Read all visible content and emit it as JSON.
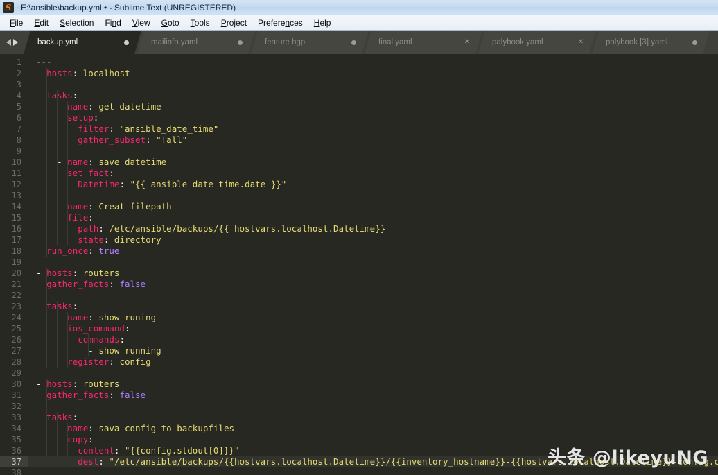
{
  "window": {
    "title": "E:\\ansible\\backup.yml • - Sublime Text (UNREGISTERED)",
    "icon": "sublime-text-icon",
    "icon_glyph": "S"
  },
  "menubar": {
    "items": [
      {
        "label": "File",
        "mnemonic": "F"
      },
      {
        "label": "Edit",
        "mnemonic": "E"
      },
      {
        "label": "Selection",
        "mnemonic": "S"
      },
      {
        "label": "Find",
        "mnemonic": "n"
      },
      {
        "label": "View",
        "mnemonic": "V"
      },
      {
        "label": "Goto",
        "mnemonic": "G"
      },
      {
        "label": "Tools",
        "mnemonic": "T"
      },
      {
        "label": "Project",
        "mnemonic": "P"
      },
      {
        "label": "Preferences",
        "mnemonic": "n"
      },
      {
        "label": "Help",
        "mnemonic": "H"
      }
    ]
  },
  "tabbar": {
    "nav_prev_icon": "arrow-left-icon",
    "nav_next_icon": "arrow-right-icon",
    "tabs": [
      {
        "label": "backup.yml",
        "active": true,
        "close_icon": "unsaved-dot-icon"
      },
      {
        "label": "mailinfo.yaml",
        "active": false,
        "close_icon": "unsaved-dot-icon"
      },
      {
        "label": "feature bgp",
        "active": false,
        "close_icon": "unsaved-dot-icon"
      },
      {
        "label": "final.yaml",
        "active": false,
        "close_icon": "close-x-icon"
      },
      {
        "label": "palybook.yaml",
        "active": false,
        "close_icon": "close-x-icon"
      },
      {
        "label": "palybook [3].yaml",
        "active": false,
        "close_icon": "unsaved-dot-icon"
      }
    ]
  },
  "editor": {
    "active_line": 37,
    "colors": {
      "background": "#272822",
      "key": "#f92672",
      "string": "#e6db74",
      "constant": "#ae81ff",
      "comment": "#75715e",
      "foreground": "#f8f8f2",
      "gutter_text": "#6a6b62",
      "active_line_bg": "#32332c"
    },
    "lines": [
      {
        "n": 1,
        "tokens": [
          {
            "t": "---",
            "c": "c"
          }
        ]
      },
      {
        "n": 2,
        "tokens": [
          {
            "t": "- ",
            "c": "p"
          },
          {
            "t": "hosts",
            "c": "k"
          },
          {
            "t": ": ",
            "c": "p"
          },
          {
            "t": "localhost",
            "c": "s"
          }
        ]
      },
      {
        "n": 3,
        "tokens": []
      },
      {
        "n": 4,
        "tokens": [
          {
            "t": "  ",
            "c": "p"
          },
          {
            "t": "tasks",
            "c": "k"
          },
          {
            "t": ":",
            "c": "p"
          }
        ]
      },
      {
        "n": 5,
        "tokens": [
          {
            "t": "    - ",
            "c": "p"
          },
          {
            "t": "name",
            "c": "k"
          },
          {
            "t": ": ",
            "c": "p"
          },
          {
            "t": "get datetime",
            "c": "s"
          }
        ]
      },
      {
        "n": 6,
        "tokens": [
          {
            "t": "      ",
            "c": "p"
          },
          {
            "t": "setup",
            "c": "k"
          },
          {
            "t": ":",
            "c": "p"
          }
        ]
      },
      {
        "n": 7,
        "tokens": [
          {
            "t": "        ",
            "c": "p"
          },
          {
            "t": "filter",
            "c": "k"
          },
          {
            "t": ": ",
            "c": "p"
          },
          {
            "t": "\"ansible_date_time\"",
            "c": "s"
          }
        ]
      },
      {
        "n": 8,
        "tokens": [
          {
            "t": "        ",
            "c": "p"
          },
          {
            "t": "gather_subset",
            "c": "k"
          },
          {
            "t": ": ",
            "c": "p"
          },
          {
            "t": "\"!all\"",
            "c": "s"
          }
        ]
      },
      {
        "n": 9,
        "tokens": []
      },
      {
        "n": 10,
        "tokens": [
          {
            "t": "    - ",
            "c": "p"
          },
          {
            "t": "name",
            "c": "k"
          },
          {
            "t": ": ",
            "c": "p"
          },
          {
            "t": "save datetime",
            "c": "s"
          }
        ]
      },
      {
        "n": 11,
        "tokens": [
          {
            "t": "      ",
            "c": "p"
          },
          {
            "t": "set_fact",
            "c": "k"
          },
          {
            "t": ":",
            "c": "p"
          }
        ]
      },
      {
        "n": 12,
        "tokens": [
          {
            "t": "        ",
            "c": "p"
          },
          {
            "t": "Datetime",
            "c": "k"
          },
          {
            "t": ": ",
            "c": "p"
          },
          {
            "t": "\"{{ ansible_date_time.date }}\"",
            "c": "s"
          }
        ]
      },
      {
        "n": 13,
        "tokens": []
      },
      {
        "n": 14,
        "tokens": [
          {
            "t": "    - ",
            "c": "p"
          },
          {
            "t": "name",
            "c": "k"
          },
          {
            "t": ": ",
            "c": "p"
          },
          {
            "t": "Creat filepath",
            "c": "s"
          }
        ]
      },
      {
        "n": 15,
        "tokens": [
          {
            "t": "      ",
            "c": "p"
          },
          {
            "t": "file",
            "c": "k"
          },
          {
            "t": ":",
            "c": "p"
          }
        ]
      },
      {
        "n": 16,
        "tokens": [
          {
            "t": "        ",
            "c": "p"
          },
          {
            "t": "path",
            "c": "k"
          },
          {
            "t": ": ",
            "c": "p"
          },
          {
            "t": "/etc/ansible/backups/{{ hostvars.localhost.Datetime}}",
            "c": "s"
          }
        ]
      },
      {
        "n": 17,
        "tokens": [
          {
            "t": "        ",
            "c": "p"
          },
          {
            "t": "state",
            "c": "k"
          },
          {
            "t": ": ",
            "c": "p"
          },
          {
            "t": "directory",
            "c": "s"
          }
        ]
      },
      {
        "n": 18,
        "tokens": [
          {
            "t": "  ",
            "c": "p"
          },
          {
            "t": "run_once",
            "c": "k"
          },
          {
            "t": ": ",
            "c": "p"
          },
          {
            "t": "true",
            "c": "n"
          }
        ]
      },
      {
        "n": 19,
        "tokens": []
      },
      {
        "n": 20,
        "tokens": [
          {
            "t": "- ",
            "c": "p"
          },
          {
            "t": "hosts",
            "c": "k"
          },
          {
            "t": ": ",
            "c": "p"
          },
          {
            "t": "routers",
            "c": "s"
          }
        ]
      },
      {
        "n": 21,
        "tokens": [
          {
            "t": "  ",
            "c": "p"
          },
          {
            "t": "gather_facts",
            "c": "k"
          },
          {
            "t": ": ",
            "c": "p"
          },
          {
            "t": "false",
            "c": "n"
          }
        ]
      },
      {
        "n": 22,
        "tokens": []
      },
      {
        "n": 23,
        "tokens": [
          {
            "t": "  ",
            "c": "p"
          },
          {
            "t": "tasks",
            "c": "k"
          },
          {
            "t": ":",
            "c": "p"
          }
        ]
      },
      {
        "n": 24,
        "tokens": [
          {
            "t": "    - ",
            "c": "p"
          },
          {
            "t": "name",
            "c": "k"
          },
          {
            "t": ": ",
            "c": "p"
          },
          {
            "t": "show runing",
            "c": "s"
          }
        ]
      },
      {
        "n": 25,
        "tokens": [
          {
            "t": "      ",
            "c": "p"
          },
          {
            "t": "ios_command",
            "c": "k"
          },
          {
            "t": ":",
            "c": "p"
          }
        ]
      },
      {
        "n": 26,
        "tokens": [
          {
            "t": "        ",
            "c": "p"
          },
          {
            "t": "commands",
            "c": "k"
          },
          {
            "t": ":",
            "c": "p"
          }
        ]
      },
      {
        "n": 27,
        "tokens": [
          {
            "t": "          - ",
            "c": "p"
          },
          {
            "t": "show running",
            "c": "s"
          }
        ]
      },
      {
        "n": 28,
        "tokens": [
          {
            "t": "      ",
            "c": "p"
          },
          {
            "t": "register",
            "c": "k"
          },
          {
            "t": ": ",
            "c": "p"
          },
          {
            "t": "config",
            "c": "s"
          }
        ]
      },
      {
        "n": 29,
        "tokens": []
      },
      {
        "n": 30,
        "tokens": [
          {
            "t": "- ",
            "c": "p"
          },
          {
            "t": "hosts",
            "c": "k"
          },
          {
            "t": ": ",
            "c": "p"
          },
          {
            "t": "routers",
            "c": "s"
          }
        ]
      },
      {
        "n": 31,
        "tokens": [
          {
            "t": "  ",
            "c": "p"
          },
          {
            "t": "gather_facts",
            "c": "k"
          },
          {
            "t": ": ",
            "c": "p"
          },
          {
            "t": "false",
            "c": "n"
          }
        ]
      },
      {
        "n": 32,
        "tokens": []
      },
      {
        "n": 33,
        "tokens": [
          {
            "t": "  ",
            "c": "p"
          },
          {
            "t": "tasks",
            "c": "k"
          },
          {
            "t": ":",
            "c": "p"
          }
        ]
      },
      {
        "n": 34,
        "tokens": [
          {
            "t": "    - ",
            "c": "p"
          },
          {
            "t": "name",
            "c": "k"
          },
          {
            "t": ": ",
            "c": "p"
          },
          {
            "t": "sava config to backupfiles",
            "c": "s"
          }
        ]
      },
      {
        "n": 35,
        "tokens": [
          {
            "t": "      ",
            "c": "p"
          },
          {
            "t": "copy",
            "c": "k"
          },
          {
            "t": ":",
            "c": "p"
          }
        ]
      },
      {
        "n": 36,
        "tokens": [
          {
            "t": "        ",
            "c": "p"
          },
          {
            "t": "content",
            "c": "k"
          },
          {
            "t": ": ",
            "c": "p"
          },
          {
            "t": "\"{{config.stdout[0]}}\"",
            "c": "s"
          }
        ]
      },
      {
        "n": 37,
        "tokens": [
          {
            "t": "        ",
            "c": "p"
          },
          {
            "t": "dest",
            "c": "k"
          },
          {
            "t": ": ",
            "c": "p"
          },
          {
            "t": "\"/etc/ansible/backups/{{hostvars.localhost.Datetime}}/{{inventory_hostname}}-{{hostvars.localhost.Datetime}}-config.cfg",
            "c": "s"
          }
        ]
      },
      {
        "n": 38,
        "tokens": []
      }
    ]
  },
  "watermark": {
    "text": "头条 @likeyuNG"
  }
}
